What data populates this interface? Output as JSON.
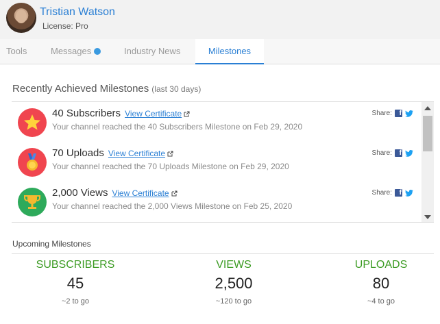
{
  "user": {
    "name": "Tristian Watson",
    "license_label": "License:",
    "license_value": "Pro"
  },
  "tabs": [
    {
      "label": "Tools",
      "active": false
    },
    {
      "label": "Messages",
      "active": false,
      "has_notification": true
    },
    {
      "label": "Industry News",
      "active": false
    },
    {
      "label": "Milestones",
      "active": true
    }
  ],
  "recent": {
    "title": "Recently Achieved Milestones",
    "subtitle": "(last 30 days)",
    "cert_link": "View Certificate",
    "share_label": "Share:",
    "items": [
      {
        "title": "40 Subscribers",
        "description": "Your channel reached the 40 Subscribers Milestone on Feb 29, 2020",
        "icon": "star-icon",
        "color": "#f0454f"
      },
      {
        "title": "70 Uploads",
        "description": "Your channel reached the 70 Uploads Milestone on Feb 29, 2020",
        "icon": "medal-icon",
        "color": "#f0454f"
      },
      {
        "title": "2,000 Views",
        "description": "Your channel reached the 2,000 Views Milestone on Feb 25, 2020",
        "icon": "trophy-icon",
        "color": "#2eaa5b"
      }
    ]
  },
  "upcoming": {
    "title": "Upcoming Milestones",
    "stats": [
      {
        "label": "SUBSCRIBERS",
        "value": "45",
        "togo": "~2 to go"
      },
      {
        "label": "VIEWS",
        "value": "2,500",
        "togo": "~120 to go"
      },
      {
        "label": "UPLOADS",
        "value": "80",
        "togo": "~4 to go"
      }
    ]
  },
  "colors": {
    "accent": "#2a7fd4",
    "stat_green": "#3b9b22",
    "facebook": "#3b5998",
    "twitter": "#1da1f2"
  }
}
